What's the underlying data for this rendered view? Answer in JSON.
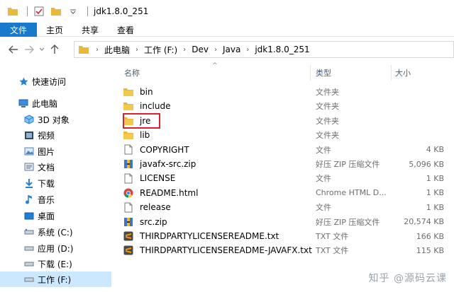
{
  "window": {
    "title": "jdk1.8.0_251"
  },
  "ribbon": {
    "tabs": [
      "文件",
      "主页",
      "共享",
      "查看"
    ]
  },
  "address": {
    "crumbs": [
      "此电脑",
      "工作 (F:)",
      "Dev",
      "Java",
      "jdk1.8.0_251"
    ]
  },
  "nav": {
    "items": [
      {
        "label": "快速访问",
        "icon": "star-icon"
      },
      {
        "label": "此电脑",
        "icon": "computer-icon"
      },
      {
        "label": "3D 对象",
        "icon": "cube-icon"
      },
      {
        "label": "视频",
        "icon": "video-icon"
      },
      {
        "label": "图片",
        "icon": "picture-icon"
      },
      {
        "label": "文档",
        "icon": "document-icon"
      },
      {
        "label": "下载",
        "icon": "download-icon"
      },
      {
        "label": "音乐",
        "icon": "music-icon"
      },
      {
        "label": "桌面",
        "icon": "desktop-icon"
      },
      {
        "label": "系统 (C:)",
        "icon": "drive-icon"
      },
      {
        "label": "应用 (D:)",
        "icon": "drive-icon"
      },
      {
        "label": "下载 (E:)",
        "icon": "drive-icon"
      },
      {
        "label": "工作 (F:)",
        "icon": "drive-icon"
      }
    ]
  },
  "list": {
    "headers": {
      "name": "名称",
      "type": "类型",
      "size": "大小"
    },
    "rows": [
      {
        "name": "bin",
        "type": "文件夹",
        "size": "",
        "icon": "folder-icon"
      },
      {
        "name": "include",
        "type": "文件夹",
        "size": "",
        "icon": "folder-icon"
      },
      {
        "name": "jre",
        "type": "文件夹",
        "size": "",
        "icon": "folder-icon"
      },
      {
        "name": "lib",
        "type": "文件夹",
        "size": "",
        "icon": "folder-icon"
      },
      {
        "name": "COPYRIGHT",
        "type": "文件",
        "size": "4 KB",
        "icon": "file-icon"
      },
      {
        "name": "javafx-src.zip",
        "type": "好压 ZIP 压缩文件",
        "size": "5,096 KB",
        "icon": "zip-icon"
      },
      {
        "name": "LICENSE",
        "type": "文件",
        "size": "1 KB",
        "icon": "file-icon"
      },
      {
        "name": "README.html",
        "type": "Chrome HTML D...",
        "size": "1 KB",
        "icon": "chrome-icon"
      },
      {
        "name": "release",
        "type": "文件",
        "size": "1 KB",
        "icon": "file-icon"
      },
      {
        "name": "src.zip",
        "type": "好压 ZIP 压缩文件",
        "size": "20,574 KB",
        "icon": "zip-icon"
      },
      {
        "name": "THIRDPARTYLICENSEREADME.txt",
        "type": "TXT 文件",
        "size": "166 KB",
        "icon": "sublime-icon"
      },
      {
        "name": "THIRDPARTYLICENSEREADME-JAVAFX.txt",
        "type": "TXT 文件",
        "size": "115 KB",
        "icon": "sublime-icon"
      }
    ]
  },
  "watermark": "知乎 @源码云课",
  "colors": {
    "accent": "#1979ca",
    "folder": "#e8b93a",
    "selection": "#cce8ff",
    "highlight": "#d5232f"
  }
}
